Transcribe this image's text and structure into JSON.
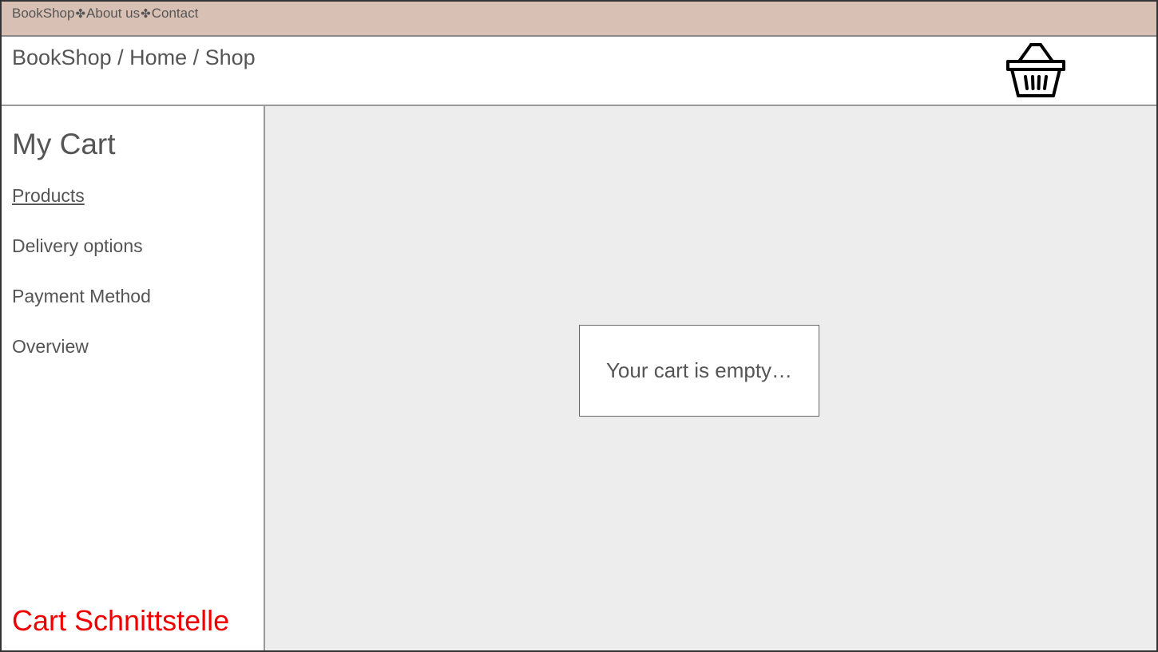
{
  "topnav": {
    "items": [
      "BookShop",
      "About us",
      "Contact"
    ],
    "separator": "✤"
  },
  "header": {
    "breadcrumb": "BookShop / Home / Shop",
    "cart_icon": "shopping-basket-icon"
  },
  "sidebar": {
    "title": "My Cart",
    "items": [
      {
        "label": "Products",
        "active": true
      },
      {
        "label": "Delivery options",
        "active": false
      },
      {
        "label": "Payment Method",
        "active": false
      },
      {
        "label": "Overview",
        "active": false
      }
    ],
    "footer_label": "Cart Schnittstelle"
  },
  "main": {
    "empty_message": "Your cart is empty…"
  },
  "colors": {
    "topbar_bg": "#d8c0b4",
    "main_bg": "#ededed",
    "text": "#555555",
    "accent_red": "#ee0000"
  }
}
